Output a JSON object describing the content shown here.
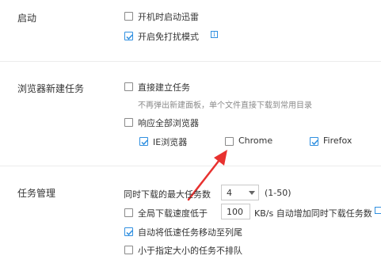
{
  "startup": {
    "title": "启动",
    "options": [
      {
        "label": "开机时启动迅雷",
        "checked": false
      },
      {
        "label": "开启免打扰模式",
        "checked": true
      }
    ],
    "info_icon": "info-icon"
  },
  "browser_task": {
    "title": "浏览器新建任务",
    "direct_create": {
      "label": "直接建立任务",
      "checked": false
    },
    "direct_create_desc": "不再弹出新建面板，单个文件直接下载到常用目录",
    "respond_all": {
      "label": "响应全部浏览器",
      "checked": false
    },
    "browsers": [
      {
        "label": "IE浏览器",
        "checked": true
      },
      {
        "label": "Chrome",
        "checked": false
      },
      {
        "label": "Firefox",
        "checked": true
      }
    ]
  },
  "task_mgmt": {
    "title": "任务管理",
    "max_tasks_label": "同时下载的最大任务数",
    "max_tasks_value": "4",
    "max_tasks_range": "(1-50)",
    "speed_limit": {
      "label": "全局下载速度低于",
      "checked": false
    },
    "speed_value": "100",
    "speed_suffix": "KB/s 自动增加同时下载任务数",
    "move_slow": {
      "label": "自动将低速任务移动至列尾",
      "checked": true
    },
    "no_queue_small": {
      "label": "小于指定大小的任务不排队",
      "checked": false
    }
  },
  "colors": {
    "accent": "#2f8fe0",
    "arrow": "#e8312f"
  }
}
